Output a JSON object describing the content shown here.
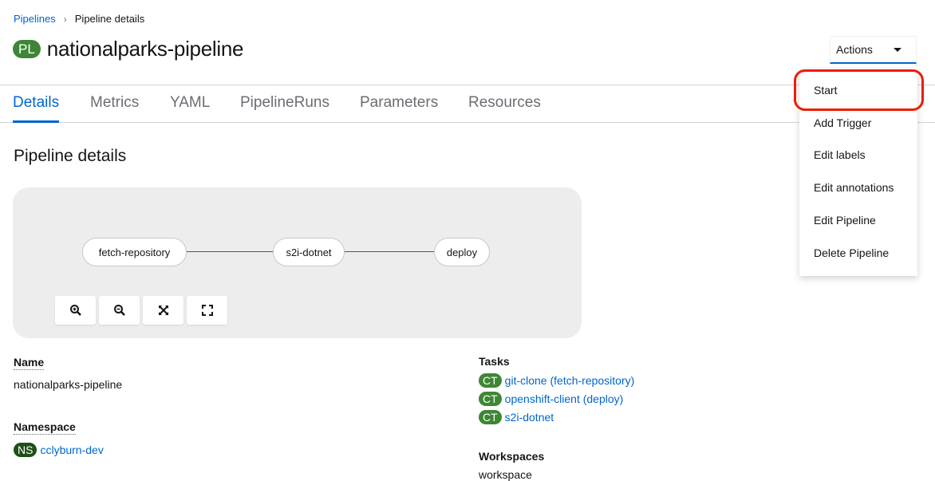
{
  "breadcrumb": {
    "parent": "Pipelines",
    "current": "Pipeline details"
  },
  "header": {
    "badge": "PL",
    "title": "nationalparks-pipeline",
    "actions_label": "Actions"
  },
  "tabs": [
    "Details",
    "Metrics",
    "YAML",
    "PipelineRuns",
    "Parameters",
    "Resources"
  ],
  "active_tab": "Details",
  "section_title": "Pipeline details",
  "topology": {
    "nodes": [
      "fetch-repository",
      "s2i-dotnet",
      "deploy"
    ],
    "controls": [
      "zoom-in-icon",
      "zoom-out-icon",
      "fit-to-screen-icon",
      "expand-icon"
    ]
  },
  "details": {
    "name_label": "Name",
    "name_value": "nationalparks-pipeline",
    "namespace_label": "Namespace",
    "namespace_badge": "NS",
    "namespace_value": "cclyburn-dev",
    "tasks_label": "Tasks",
    "tasks": [
      {
        "badge": "CT",
        "label": "git-clone (fetch-repository)"
      },
      {
        "badge": "CT",
        "label": "openshift-client (deploy)"
      },
      {
        "badge": "CT",
        "label": "s2i-dotnet"
      }
    ],
    "workspaces_label": "Workspaces",
    "workspace_value": "workspace"
  },
  "menu": {
    "items": [
      "Start",
      "Add Trigger",
      "Edit labels",
      "Edit annotations",
      "Edit Pipeline",
      "Delete Pipeline"
    ],
    "highlighted": "Start"
  },
  "colors": {
    "accent": "#0066cc",
    "badge_green": "#3e8635",
    "ns_badge": "#1e4f18",
    "highlight": "#ee1c00"
  }
}
